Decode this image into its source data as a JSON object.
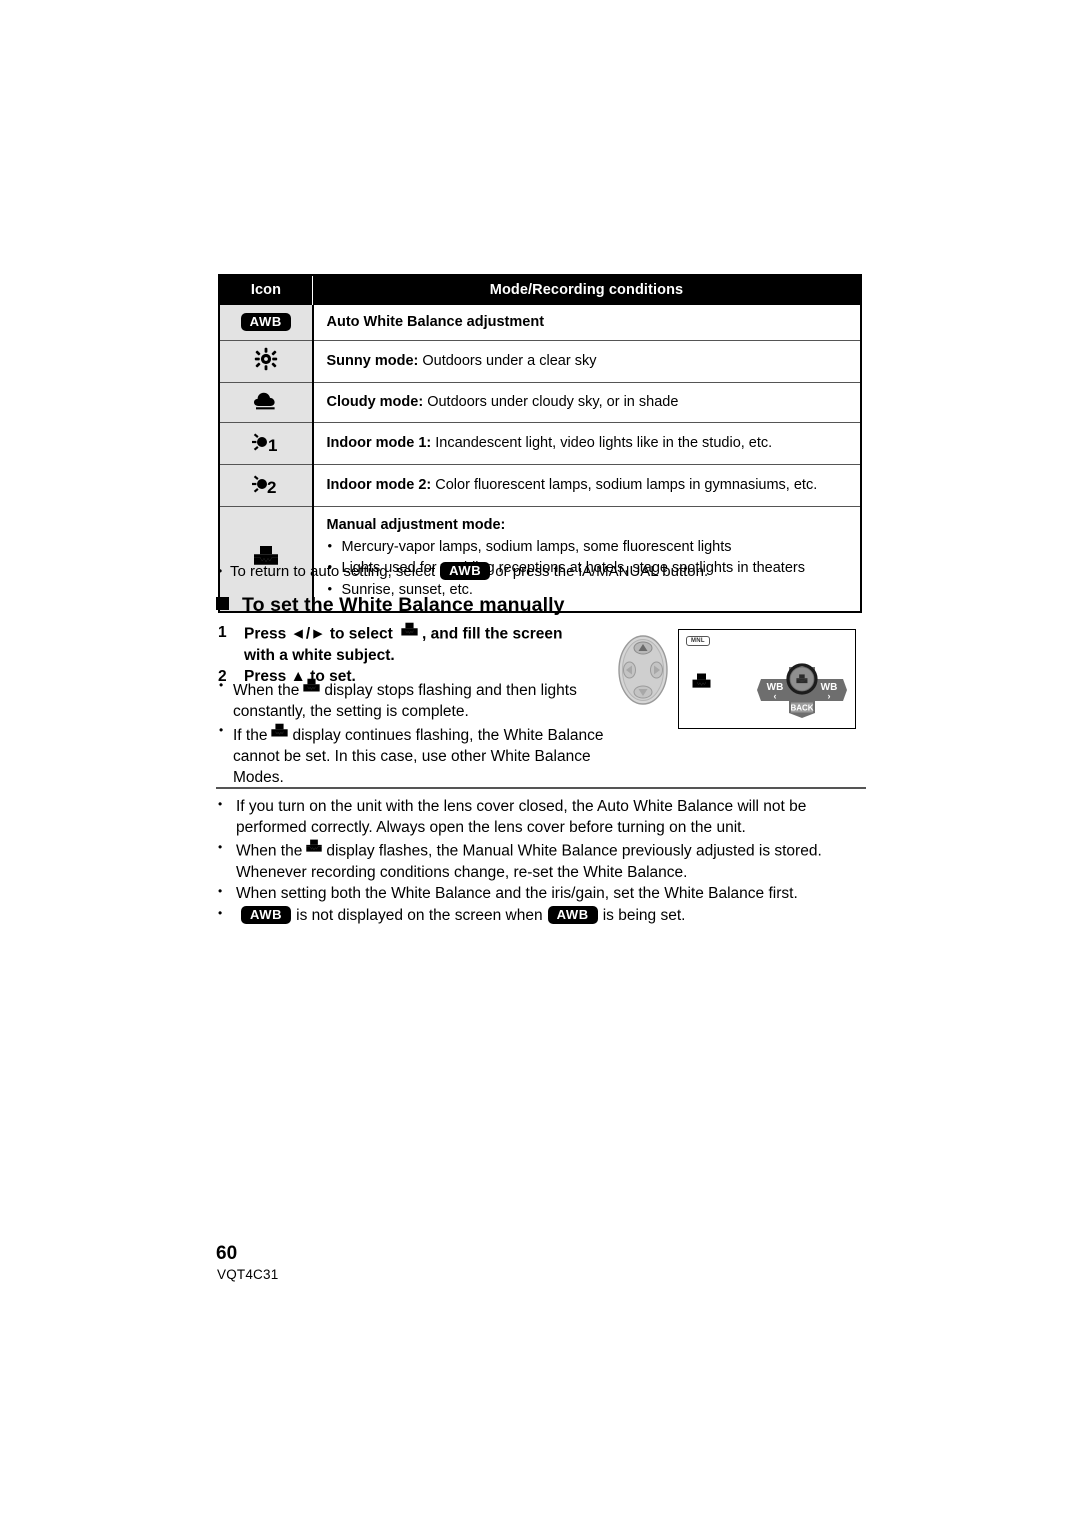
{
  "table": {
    "headers": [
      "Icon",
      "Mode/Recording conditions"
    ],
    "rows": [
      {
        "icon": "awb-badge-icon",
        "icon_text": "AWB",
        "label": "Auto White Balance adjustment",
        "description": ""
      },
      {
        "icon": "sunny-mode-icon",
        "label": "Sunny mode:",
        "description": " Outdoors under a clear sky"
      },
      {
        "icon": "cloudy-mode-icon",
        "label": "Cloudy mode:",
        "description": " Outdoors under cloudy sky, or in shade"
      },
      {
        "icon": "indoor-mode-1-icon",
        "label": "Indoor mode 1:",
        "description": " Incandescent light, video lights like in the studio, etc."
      },
      {
        "icon": "indoor-mode-2-icon",
        "label": "Indoor mode 2:",
        "description": " Color fluorescent lamps, sodium lamps in gymnasiums, etc."
      },
      {
        "icon": "manual-white-balance-icon",
        "label": "Manual adjustment mode:",
        "description": "",
        "bullets": [
          "Mercury-vapor lamps, sodium lamps, some fluorescent lights",
          "Lights used for wedding receptions at hotels, stage spotlights in theaters",
          "Sunrise, sunset, etc."
        ]
      }
    ]
  },
  "auto_setting_note": {
    "part1": "To return to auto setting, select",
    "badge": "AWB",
    "part2": "or press the iA/MANUAL button."
  },
  "section": {
    "heading": "To set the White Balance manually"
  },
  "steps": [
    {
      "number": "1",
      "text_before": "Press ",
      "arrows": "◄/►",
      "text_mid": " to select ",
      "text_after": ", and fill the screen",
      "line2": "with a white subject."
    },
    {
      "number": "2",
      "full": "Press ▲ to set."
    }
  ],
  "step_notes": [
    {
      "before": "When the",
      "after": "display stops flashing and then lights constantly, the setting is complete."
    },
    {
      "before": "If the",
      "after": "display continues flashing, the White Balance cannot be set. In this case, use other White Balance Modes."
    }
  ],
  "lcd_illustration": {
    "mode_badge": "MNL",
    "left_button_label": "WB",
    "left_button_arrow": "‹",
    "right_button_label": "WB",
    "right_button_arrow": "›",
    "bottom_button_label": "BACK",
    "center_icon": "manual-white-balance-icon"
  },
  "bottom_notes": [
    {
      "type": "plain",
      "text": "If you turn on the unit with the lens cover closed, the Auto White Balance will not be performed correctly. Always open the lens cover before turning on the unit."
    },
    {
      "type": "with-mwb-icon",
      "before": "When the",
      "after": "display flashes, the Manual White Balance previously adjusted is stored. Whenever recording conditions change, re-set the White Balance."
    },
    {
      "type": "plain",
      "text": "When setting both the White Balance and the iris/gain, set the White Balance first."
    },
    {
      "type": "with-awb-badges",
      "badge1": "AWB",
      "mid": "is not displayed on the screen when",
      "badge2": "AWB",
      "end": "is being set."
    }
  ],
  "footer": {
    "page_number": "60",
    "doc_code": "VQT4C31"
  },
  "colors": {
    "header_bg": "#000000",
    "header_text": "#ffffff",
    "icon_cell_bg": "#e3e3e3",
    "body_text": "#000000",
    "rule": "#555555"
  }
}
